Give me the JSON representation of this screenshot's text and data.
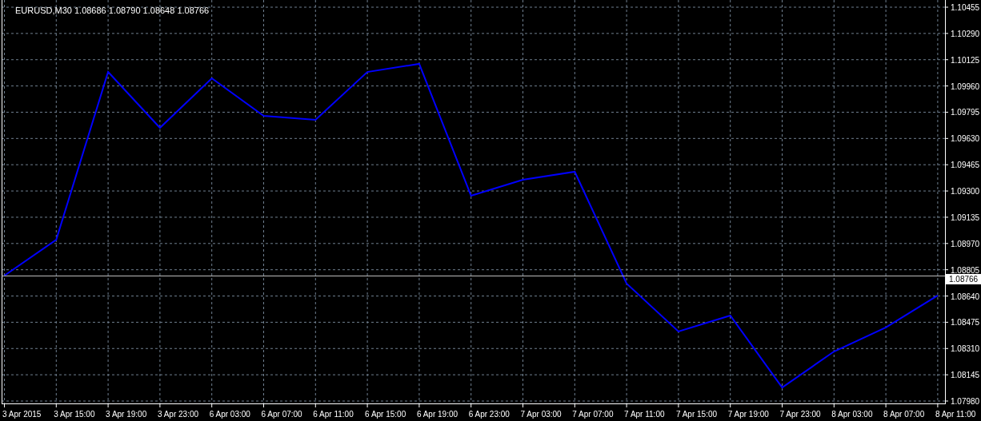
{
  "chart": {
    "symbol": "EURUSD,M30",
    "quotes": [
      "1.08686",
      "1.08790",
      "1.08648",
      "1.08766"
    ],
    "chart_data": {
      "type": "line",
      "grid": true,
      "ref_lines": [
        {
          "axis": "y",
          "value": 1.08766,
          "label": "1.08766"
        }
      ],
      "categories": [
        "3 Apr 2015",
        "3 Apr 15:00",
        "3 Apr 19:00",
        "3 Apr 23:00",
        "6 Apr 03:00",
        "6 Apr 07:00",
        "6 Apr 11:00",
        "6 Apr 15:00",
        "6 Apr 19:00",
        "6 Apr 23:00",
        "7 Apr 03:00",
        "7 Apr 07:00",
        "7 Apr 11:00",
        "7 Apr 15:00",
        "7 Apr 19:00",
        "7 Apr 23:00",
        "8 Apr 03:00",
        "8 Apr 07:00",
        "8 Apr 11:00"
      ],
      "series": [
        {
          "color": "#0000ff",
          "values": [
            1.08768,
            1.08994,
            1.10048,
            1.09697,
            1.10008,
            1.09772,
            1.09747,
            1.10048,
            1.10099,
            1.0927,
            1.09371,
            1.09421,
            1.08718,
            1.08417,
            1.08517,
            1.08065,
            1.08291,
            1.08442,
            1.08643
          ]
        }
      ],
      "ylim": [
        1.0798,
        1.10455
      ],
      "yticks": [
        {
          "value": 1.10455,
          "label": "1.10455"
        },
        {
          "value": 1.1029,
          "label": "1.10290"
        },
        {
          "value": 1.10125,
          "label": "1.10125"
        },
        {
          "value": 1.0996,
          "label": "1.09960"
        },
        {
          "value": 1.09795,
          "label": "1.09795"
        },
        {
          "value": 1.0963,
          "label": "1.09630"
        },
        {
          "value": 1.09465,
          "label": "1.09465"
        },
        {
          "value": 1.093,
          "label": "1.09300"
        },
        {
          "value": 1.09135,
          "label": "1.09135"
        },
        {
          "value": 1.0897,
          "label": "1.08970"
        },
        {
          "value": 1.08805,
          "label": "1.08805"
        },
        {
          "value": 1.0864,
          "label": "1.08640"
        },
        {
          "value": 1.08475,
          "label": "1.08475"
        },
        {
          "value": 1.0831,
          "label": "1.08310"
        },
        {
          "value": 1.08145,
          "label": "1.08145"
        },
        {
          "value": 1.0798,
          "label": "1.07980"
        }
      ]
    }
  }
}
